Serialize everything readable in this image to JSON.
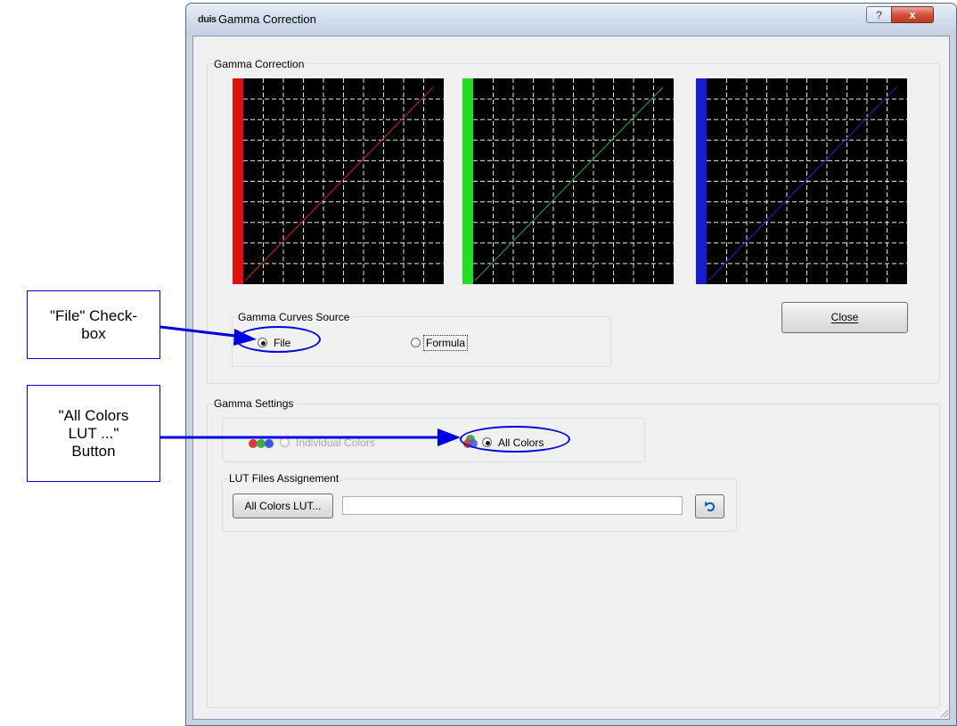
{
  "window": {
    "title": "Gamma Correction",
    "app_icon_text": "duis",
    "help_glyph": "?",
    "close_glyph": "x"
  },
  "gamma_correction": {
    "group_label": "Gamma Correction",
    "curves": [
      {
        "channel": "red",
        "color": "#e01010",
        "line_color": "#a52a1e"
      },
      {
        "channel": "green",
        "color": "#22dd22",
        "line_color": "#2f8f3f"
      },
      {
        "channel": "blue",
        "color": "#1a1ad0",
        "line_color": "#24249a"
      }
    ]
  },
  "curves_source": {
    "group_label": "Gamma Curves Source",
    "options": [
      {
        "label": "File",
        "selected": true
      },
      {
        "label": "Formula",
        "selected": false
      }
    ]
  },
  "close_button": {
    "label": "Close"
  },
  "gamma_settings": {
    "group_label": "Gamma Settings",
    "options": [
      {
        "label": "Individual Colors",
        "selected": false,
        "enabled": false
      },
      {
        "label": "All Colors",
        "selected": true,
        "enabled": true
      }
    ]
  },
  "lut_files": {
    "group_label": "LUT Files Assignement",
    "button_label": "All Colors LUT...",
    "path_value": "",
    "reset_icon": "undo-icon"
  },
  "annotations": {
    "file_callout": "\"File\" Check-box",
    "all_colors_callout": "\"All Colors LUT ...\" Button",
    "accent_color": "#0000e0"
  }
}
